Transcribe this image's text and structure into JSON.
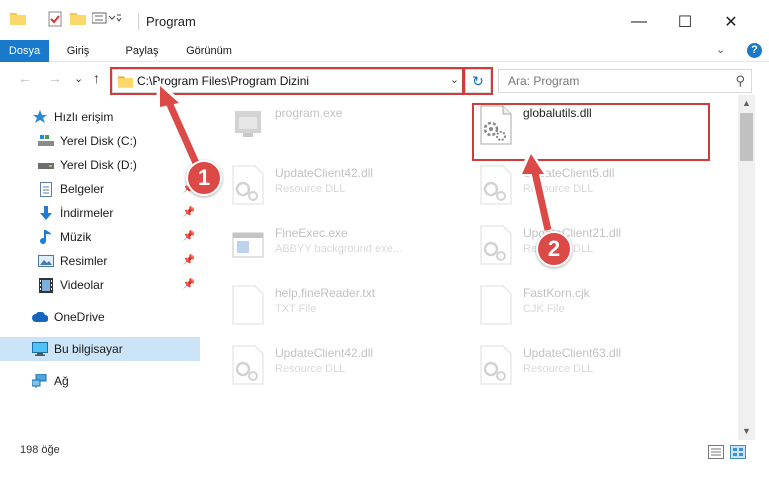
{
  "window": {
    "title": "Program",
    "minimize_icon": "—",
    "maximize_icon": "☐",
    "close_icon": "✕"
  },
  "ribbon": {
    "tabs": [
      {
        "label": "Dosya"
      },
      {
        "label": "Giriş"
      },
      {
        "label": "Paylaş"
      },
      {
        "label": "Görünüm"
      }
    ],
    "expand_icon": "⌄",
    "help_label": "?"
  },
  "nav": {
    "back": "←",
    "forward": "→",
    "recent": "⌄",
    "up": "↑",
    "address": "C:\\Program Files\\Program Dizini",
    "address_chevron": "⌄",
    "refresh": "↻",
    "search_placeholder": "Ara: Program",
    "search_icon": "⚲"
  },
  "sidebar": {
    "items": [
      {
        "label": "Hızlı erişim",
        "icon": "star-icon"
      },
      {
        "label": "Yerel Disk (C:)",
        "icon": "drive-icon"
      },
      {
        "label": "Yerel Disk (D:)",
        "icon": "drive-icon"
      },
      {
        "label": "Belgeler",
        "icon": "documents-icon"
      },
      {
        "label": "İndirmeler",
        "icon": "download-icon"
      },
      {
        "label": "Müzik",
        "icon": "music-icon"
      },
      {
        "label": "Resimler",
        "icon": "pictures-icon"
      },
      {
        "label": "Videolar",
        "icon": "video-icon"
      },
      {
        "label": "OneDrive",
        "icon": "cloud-icon"
      },
      {
        "label": "Bu bilgisayar",
        "icon": "computer-icon"
      },
      {
        "label": "Ağ",
        "icon": "network-icon"
      }
    ]
  },
  "files": [
    {
      "name": "program.exe",
      "type": "",
      "icon": "exe-icon"
    },
    {
      "name": "globalutils.dll",
      "type": "",
      "icon": "dll-icon"
    },
    {
      "name": "UpdateClient42.dll",
      "type": "Resource DLL",
      "icon": "dll-icon"
    },
    {
      "name": "UpdateClient5.dll",
      "type": "Resource DLL",
      "icon": "dll-icon"
    },
    {
      "name": "FineExec.exe",
      "type": "ABBYY background exe...",
      "icon": "app-icon"
    },
    {
      "name": "UpdateClient21.dll",
      "type": "Resource DLL",
      "icon": "dll-icon"
    },
    {
      "name": "help.fineReader.txt",
      "type": "TXT File",
      "icon": "txt-icon"
    },
    {
      "name": "FastKorn.cjk",
      "type": "CJK File",
      "icon": "file-icon"
    },
    {
      "name": "UpdateClient42.dll",
      "type": "Resource DLL",
      "icon": "dll-icon"
    },
    {
      "name": "UpdateClient63.dll",
      "type": "Resource DLL",
      "icon": "dll-icon"
    }
  ],
  "status": {
    "count": "198 öğe"
  },
  "callouts": [
    {
      "label": "1"
    },
    {
      "label": "2"
    }
  ],
  "colors": {
    "accent": "#1979ca",
    "callout": "#dc4a48",
    "selected": "#cce4f7"
  }
}
